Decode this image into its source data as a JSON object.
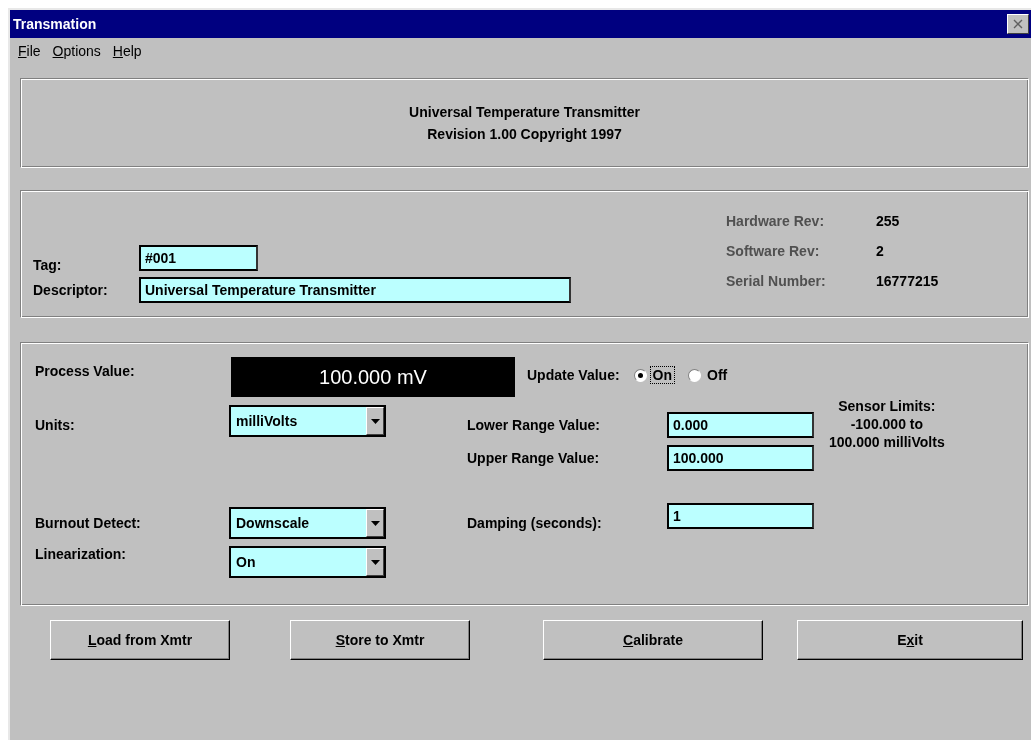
{
  "window": {
    "title": "Transmation"
  },
  "menu": [
    {
      "key": "F",
      "post": "ile"
    },
    {
      "key": "O",
      "post": "ptions"
    },
    {
      "key": "H",
      "post": "elp"
    }
  ],
  "header": {
    "lines": [
      "Universal Temperature Transmitter",
      "Revision 1.00  Copyright 1997"
    ]
  },
  "device": {
    "fields": [
      {
        "label": "Tag:",
        "value": "#001"
      },
      {
        "label": "Descriptor:",
        "value": "Universal Temperature Transmitter"
      }
    ],
    "info": [
      {
        "label": "Hardware Rev:",
        "value": "255"
      },
      {
        "label": "Software  Rev:",
        "value": "2"
      },
      {
        "label": "Serial  Number:",
        "value": "16777215"
      }
    ]
  },
  "settings": {
    "process_value": {
      "label": "Process Value:",
      "display": "100.000 mV"
    },
    "update_value": {
      "label": "Update Value:",
      "options": [
        {
          "label": "On",
          "selected": true,
          "focused": true
        },
        {
          "label": "Off",
          "selected": false,
          "focused": false
        }
      ]
    },
    "units": {
      "label": "Units:",
      "value": "milliVolts"
    },
    "lower_range": {
      "label": "Lower Range Value:",
      "value": "0.000"
    },
    "upper_range": {
      "label": "Upper Range Value:",
      "value": "100.000"
    },
    "sensor_limits": [
      "Sensor Limits:",
      "-100.000 to",
      "100.000 milliVolts"
    ],
    "burnout_detect": {
      "label": "Burnout Detect:",
      "value": "Downscale"
    },
    "damping": {
      "label": "Damping (seconds):",
      "value": "1"
    },
    "linearization": {
      "label": "Linearization:",
      "value": "On"
    }
  },
  "buttons": [
    {
      "key": "L",
      "post": "oad from Xmtr"
    },
    {
      "key": "S",
      "post": "tore to Xmtr"
    },
    {
      "key": "C",
      "post": "alibrate"
    },
    {
      "pre": "E",
      "key": "x",
      "post": "it"
    }
  ]
}
